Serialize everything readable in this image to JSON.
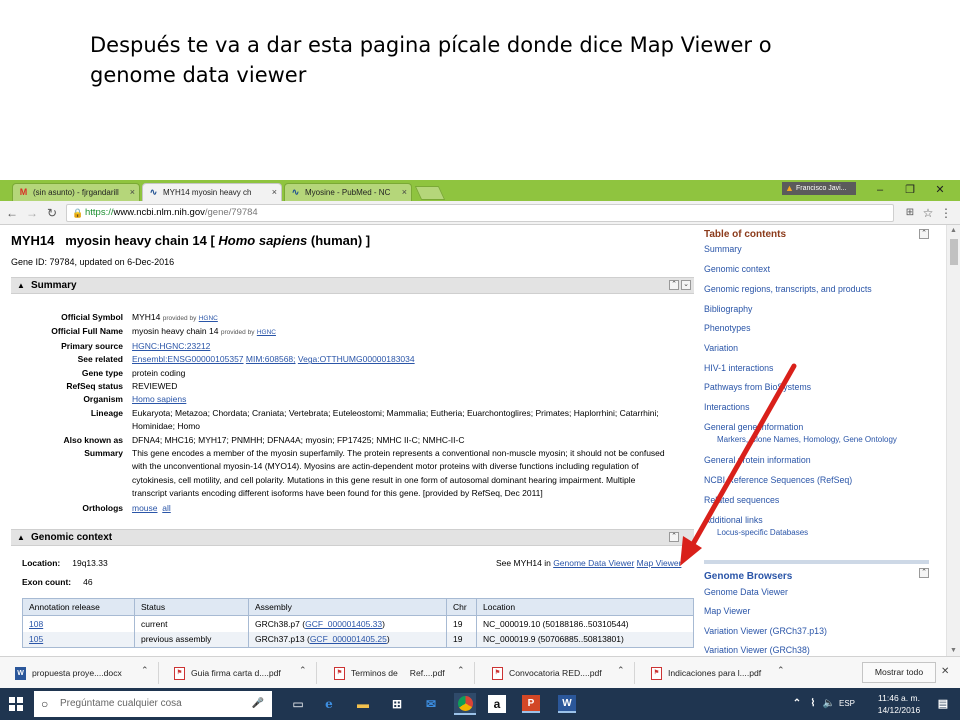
{
  "slide": {
    "caption": "Después te va a dar esta pagina pícale donde dice Map Viewer o genome data viewer"
  },
  "browser": {
    "tabs": [
      {
        "label": "(sin asunto) - fjrgandarill",
        "icon": "gmail-icon"
      },
      {
        "label": "MYH14 myosin heavy ch",
        "icon": "ncbi-icon"
      },
      {
        "label": "Myosine - PubMed - NC",
        "icon": "ncbi-icon"
      }
    ],
    "profile_name": "Francisco Javi...",
    "url_scheme": "https://",
    "url_host": "www.ncbi.nlm.nih.gov",
    "url_path": "/gene/79784"
  },
  "gene": {
    "symbol_title": "MYH14",
    "name_title": "myosin heavy chain 14 [",
    "organism_title": "Homo sapiens",
    "organism_suffix": "(human) ]",
    "id_line": "Gene ID: 79784, updated on 6-Dec-2016"
  },
  "summary": {
    "header": "Summary",
    "official_symbol_label": "Official Symbol",
    "official_symbol": "MYH14",
    "provided_by": "provided by",
    "hgnc": "HGNC",
    "official_full_name_label": "Official Full Name",
    "official_full_name": "myosin heavy chain 14",
    "primary_source_label": "Primary source",
    "primary_source": "HGNC:HGNC:23212",
    "see_related_label": "See related",
    "see_related": [
      "Ensembl:ENSG00000105357",
      "MIM:608568;",
      "Vega:OTTHUMG00000183034"
    ],
    "gene_type_label": "Gene type",
    "gene_type": "protein coding",
    "refseq_status_label": "RefSeq status",
    "refseq_status": "REVIEWED",
    "organism_label": "Organism",
    "organism": "Homo sapiens",
    "lineage_label": "Lineage",
    "lineage": "Eukaryota; Metazoa; Chordata; Craniata; Vertebrata; Euteleostomi; Mammalia; Eutheria; Euarchontoglires; Primates; Haplorrhini; Catarrhini; Hominidae; Homo",
    "also_known_label": "Also known as",
    "also_known": "DFNA4; MHC16; MYH17; PNMHH; DFNA4A; myosin; FP17425; NMHC II-C; NMHC-II-C",
    "summary_label": "Summary",
    "summary_text": "This gene encodes a member of the myosin superfamily. The protein represents a conventional non-muscle myosin; it should not be confused with the unconventional myosin-14 (MYO14). Myosins are actin-dependent motor proteins with diverse functions including regulation of cytokinesis, cell motility, and cell polarity. Mutations in this gene result in one form of autosomal dominant hearing impairment. Multiple transcript variants encoding different isoforms have been found for this gene. [provided by RefSeq, Dec 2011]",
    "orthologs_label": "Orthologs",
    "orthologs": [
      "mouse",
      "all"
    ]
  },
  "genomic_context": {
    "header": "Genomic context",
    "location_label": "Location:",
    "location": "19q13.33",
    "exon_label": "Exon count:",
    "exon_count": "46",
    "see_prefix": "See MYH14 in",
    "genome_data_viewer": "Genome Data Viewer",
    "map_viewer": "Map Viewer",
    "table": {
      "headers": [
        "Annotation release",
        "Status",
        "Assembly",
        "Chr",
        "Location"
      ],
      "rows": [
        {
          "release": "108",
          "status": "current",
          "assembly_pre": "GRCh38.p7 (",
          "assembly_link": "GCF_000001405.33",
          "assembly_post": ")",
          "chr": "19",
          "location": "NC_000019.10 (50188186..50310544)"
        },
        {
          "release": "105",
          "status": "previous assembly",
          "assembly_pre": "GRCh37.p13 (",
          "assembly_link": "GCF_000001405.25",
          "assembly_post": ")",
          "chr": "19",
          "location": "NC_000019.9 (50706885..50813801)"
        }
      ]
    }
  },
  "toc": {
    "heading": "Table of contents",
    "items": [
      "Summary",
      "Genomic context",
      "Genomic regions, transcripts, and products",
      "Bibliography",
      "Phenotypes",
      "Variation",
      "HIV-1 interactions",
      "Pathways from BioSystems",
      "Interactions",
      "General gene information"
    ],
    "gene_info_sub": "Markers, Clone Names, Homology, Gene Ontology",
    "items2": [
      "General protein information",
      "NCBI Reference Sequences (RefSeq)",
      "Related sequences",
      "Additional links"
    ],
    "additional_sub": "Locus-specific Databases",
    "browsers_heading": "Genome Browsers",
    "browsers": [
      "Genome Data Viewer",
      "Map Viewer",
      "Variation Viewer (GRCh37.p13)",
      "Variation Viewer (GRCh38)"
    ]
  },
  "downloads": {
    "items": [
      "propuesta proye....docx",
      "Guia firma carta d....pdf",
      "Terminos de     Ref....pdf",
      "Convocatoria RED....pdf",
      "Indicaciones para l....pdf"
    ],
    "show_all": "Mostrar todo"
  },
  "taskbar": {
    "search_placeholder": "Pregúntame cualquier cosa",
    "lang": "ESP",
    "time": "11:46 a. m.",
    "date": "14/12/2016"
  },
  "colors": {
    "chrome_green": "#8fc43f",
    "link": "#2a55a8",
    "toc_heading": "#8b3a1a",
    "annotation_arrow": "#d9201a",
    "taskbar": "#1f3550"
  }
}
